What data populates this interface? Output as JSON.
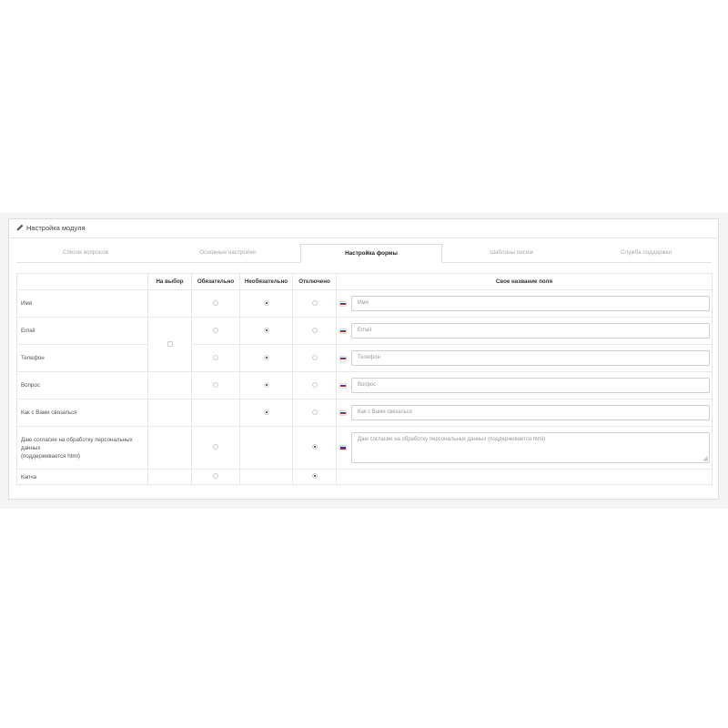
{
  "panel": {
    "title": "Настройка модуля",
    "icon": "pencil-icon"
  },
  "tabs": [
    "Список вопросов",
    "Основные настройки",
    "Настройка формы",
    "Шаблоны писем",
    "Служба поддержки"
  ],
  "active_tab": "Настройка формы",
  "table": {
    "headers": {
      "field": "",
      "choice": "На выбор",
      "required": "Обязательно",
      "optional": "Необязательно",
      "disabled": "Отключено",
      "custom_name": "Свое название поля"
    },
    "rows": [
      {
        "label": "Имя",
        "state": "optional",
        "input_placeholder": "Имя"
      },
      {
        "label": "Email",
        "state": "optional",
        "input_placeholder": "Email"
      },
      {
        "label": "Телефон",
        "state": "optional",
        "input_placeholder": "Телефон"
      },
      {
        "label": "Вопрос",
        "state": "optional",
        "input_placeholder": "Вопрос"
      },
      {
        "label": "Как с Вами связаться",
        "state": "optional",
        "input_placeholder": "Как с Вами связаться"
      },
      {
        "label_line1": "Даю согласие на обработку персональных данных",
        "label_line2": "(поддерживается html)",
        "state": "disabled",
        "input_placeholder": "Даю согласие на обработку персональных данных (поддерживается html)"
      },
      {
        "label": "Капча",
        "state": "disabled"
      }
    ]
  },
  "colors": {
    "flag_white": "#ffffff",
    "flag_blue": "#2a3fa8",
    "flag_red": "#d52b1e"
  }
}
